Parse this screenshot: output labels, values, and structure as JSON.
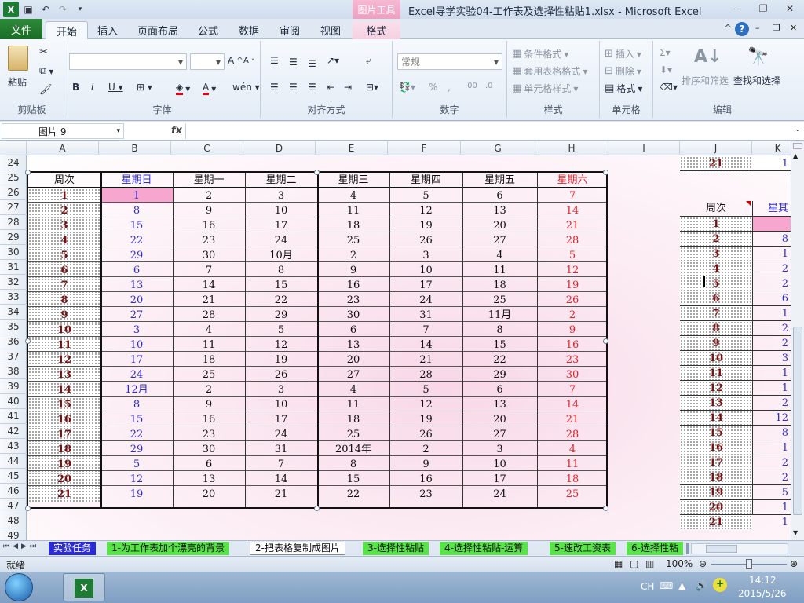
{
  "window": {
    "title": "Excel导学实验04-工作表及选择性粘贴1.xlsx  -  Microsoft Excel",
    "picture_tools": "图片工具",
    "min": "–",
    "restore": "❐",
    "close": "✕"
  },
  "ribbon_tabs": [
    "文件",
    "开始",
    "插入",
    "页面布局",
    "公式",
    "数据",
    "审阅",
    "视图",
    "格式"
  ],
  "ribbon": {
    "clipboard": {
      "label": "剪贴板",
      "paste": "粘贴"
    },
    "font": {
      "label": "字体"
    },
    "alignment": {
      "label": "对齐方式"
    },
    "number": {
      "label": "数字",
      "format": "常规"
    },
    "styles": {
      "label": "样式",
      "conditional": "条件格式",
      "table": "套用表格格式",
      "cell": "单元格样式"
    },
    "cells": {
      "label": "单元格",
      "insert": "插入",
      "delete": "删除",
      "format": "格式"
    },
    "editing": {
      "label": "编辑",
      "sort": "排序和筛选",
      "find": "查找和选择"
    }
  },
  "formula_bar": {
    "name_box": "图片  9",
    "fx": "fx"
  },
  "columns": [
    "A",
    "B",
    "C",
    "D",
    "E",
    "F",
    "G",
    "H",
    "I",
    "J",
    "K"
  ],
  "rows": [
    "24",
    "25",
    "26",
    "27",
    "28",
    "29",
    "30",
    "31",
    "32",
    "33",
    "34",
    "35",
    "36",
    "37",
    "38",
    "39",
    "40",
    "41",
    "42",
    "43",
    "44",
    "45",
    "46",
    "47",
    "48",
    "49"
  ],
  "table": {
    "headers": [
      "周次",
      "星期日",
      "星期一",
      "星期二",
      "星期三",
      "星期四",
      "星期五",
      "星期六"
    ],
    "rows": [
      [
        "1",
        "1",
        "2",
        "3",
        "4",
        "5",
        "6",
        "7"
      ],
      [
        "2",
        "8",
        "9",
        "10",
        "11",
        "12",
        "13",
        "14"
      ],
      [
        "3",
        "15",
        "16",
        "17",
        "18",
        "19",
        "20",
        "21"
      ],
      [
        "4",
        "22",
        "23",
        "24",
        "25",
        "26",
        "27",
        "28"
      ],
      [
        "5",
        "29",
        "30",
        "10月",
        "2",
        "3",
        "4",
        "5"
      ],
      [
        "6",
        "6",
        "7",
        "8",
        "9",
        "10",
        "11",
        "12"
      ],
      [
        "7",
        "13",
        "14",
        "15",
        "16",
        "17",
        "18",
        "19"
      ],
      [
        "8",
        "20",
        "21",
        "22",
        "23",
        "24",
        "25",
        "26"
      ],
      [
        "9",
        "27",
        "28",
        "29",
        "30",
        "31",
        "11月",
        "2"
      ],
      [
        "10",
        "3",
        "4",
        "5",
        "6",
        "7",
        "8",
        "9"
      ],
      [
        "11",
        "10",
        "11",
        "12",
        "13",
        "14",
        "15",
        "16"
      ],
      [
        "12",
        "17",
        "18",
        "19",
        "20",
        "21",
        "22",
        "23"
      ],
      [
        "13",
        "24",
        "25",
        "26",
        "27",
        "28",
        "29",
        "30"
      ],
      [
        "14",
        "12月",
        "2",
        "3",
        "4",
        "5",
        "6",
        "7"
      ],
      [
        "15",
        "8",
        "9",
        "10",
        "11",
        "12",
        "13",
        "14"
      ],
      [
        "16",
        "15",
        "16",
        "17",
        "18",
        "19",
        "20",
        "21"
      ],
      [
        "17",
        "22",
        "23",
        "24",
        "25",
        "26",
        "27",
        "28"
      ],
      [
        "18",
        "29",
        "30",
        "31",
        "2014年",
        "2",
        "3",
        "4"
      ],
      [
        "19",
        "5",
        "6",
        "7",
        "8",
        "9",
        "10",
        "11"
      ],
      [
        "20",
        "12",
        "13",
        "14",
        "15",
        "16",
        "17",
        "18"
      ],
      [
        "21",
        "19",
        "20",
        "21",
        "22",
        "23",
        "24",
        "25"
      ]
    ]
  },
  "right_table": {
    "top_j": "21",
    "top_k": "1",
    "header_week": "周次",
    "header_sun": "星其",
    "weeks": [
      "1",
      "2",
      "3",
      "4",
      "5",
      "6",
      "7",
      "8",
      "9",
      "10",
      "11",
      "12",
      "13",
      "14",
      "15",
      "16",
      "17",
      "18",
      "19",
      "20",
      "21"
    ],
    "sun_partial": [
      "",
      "8",
      "1",
      "2",
      "2",
      "6",
      "1",
      "2",
      "2",
      "3",
      "1",
      "1",
      "2",
      "12",
      "8",
      "1",
      "2",
      "2",
      "5",
      "1",
      "1"
    ]
  },
  "sheet_tabs": [
    "实验任务",
    "1-为工作表加个漂亮的背景",
    "2-把表格复制成图片",
    "3-选择性粘贴",
    "4-选择性粘贴-运算",
    "5-速改工资表",
    "6-选择性粘"
  ],
  "status": {
    "ready": "就绪",
    "zoom": "100%"
  },
  "taskbar": {
    "lang": "CH",
    "time": "14:12",
    "date": "2015/5/26"
  }
}
